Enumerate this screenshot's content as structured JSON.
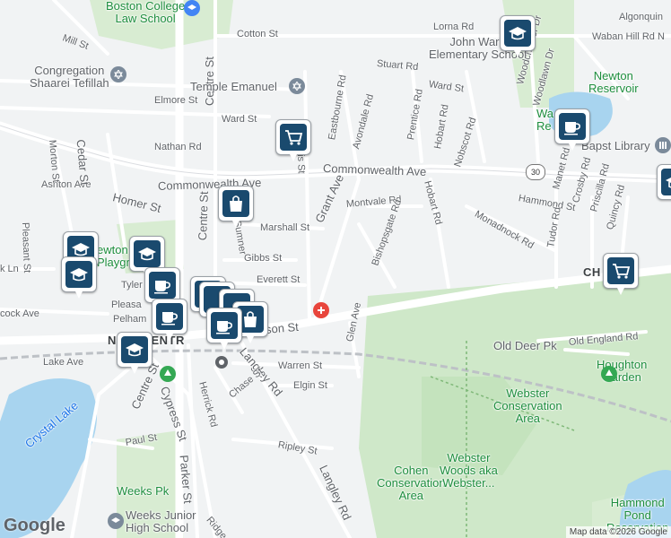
{
  "streets": [
    {
      "text": "Mill St"
    },
    {
      "text": "Cotton St"
    },
    {
      "text": "Lorna Rd"
    },
    {
      "text": "Algonquin"
    },
    {
      "text": "Stuart Rd"
    },
    {
      "text": "Ward St"
    },
    {
      "text": "Elmore St"
    },
    {
      "text": "Ward St"
    },
    {
      "text": "Nathan Rd"
    },
    {
      "text": "Francis St"
    },
    {
      "text": "Eastbourne Rd"
    },
    {
      "text": "Avondale Rd"
    },
    {
      "text": "Prentice Rd"
    },
    {
      "text": "Hobart Rd"
    },
    {
      "text": "Nobscot Rd"
    },
    {
      "text": "Woodchester Dr"
    },
    {
      "text": "Woodlawn Dr"
    },
    {
      "text": "Waban Hill Rd N"
    },
    {
      "text": "Commonwealth Ave"
    },
    {
      "text": "Commonwealth Ave"
    },
    {
      "text": "Homer St"
    },
    {
      "text": "Ashton Ave"
    },
    {
      "text": "Morton St"
    },
    {
      "text": "Cedar St"
    },
    {
      "text": "Centre St"
    },
    {
      "text": "Grant Ave"
    },
    {
      "text": "Montvale Rd"
    },
    {
      "text": "Hobart Rd"
    },
    {
      "text": "Hammond St"
    },
    {
      "text": "Manet Rd"
    },
    {
      "text": "Crosby Rd"
    },
    {
      "text": "Priscilla Rd"
    },
    {
      "text": "Quincy Rd"
    },
    {
      "text": "Monadnock Rd"
    },
    {
      "text": "Marshall St"
    },
    {
      "text": "Sumner"
    },
    {
      "text": "Centre St"
    },
    {
      "text": "Pleasant St"
    },
    {
      "text": "Gibbs St"
    },
    {
      "text": "Everett St"
    },
    {
      "text": "Tyler"
    },
    {
      "text": "Bishopsgate Rd"
    },
    {
      "text": "Tudor Rd"
    },
    {
      "text": "Pleasa"
    },
    {
      "text": "Pelham"
    },
    {
      "text": "cock Ave"
    },
    {
      "text": "Lake Ave"
    },
    {
      "text": "Glen Ave"
    },
    {
      "text": "son St"
    },
    {
      "text": "Langley Rd"
    },
    {
      "text": "Warren St"
    },
    {
      "text": "Old Deer Pk"
    },
    {
      "text": "Old England Rd"
    },
    {
      "text": "Centre St"
    },
    {
      "text": "Cypress St"
    },
    {
      "text": "Herrick Rd"
    },
    {
      "text": "Chase St"
    },
    {
      "text": "Elgin St"
    },
    {
      "text": "Paul St"
    },
    {
      "text": "Parker St"
    },
    {
      "text": "Ripley St"
    },
    {
      "text": "Langley Rd"
    },
    {
      "text": "Ridge"
    },
    {
      "text": "k Ln"
    }
  ],
  "places": [
    {
      "text": "Boston College\nLaw School"
    },
    {
      "text": "John Ward\nElementary School"
    },
    {
      "text": "Congregation\nShaarei Tefillah"
    },
    {
      "text": "Temple Emanuel"
    },
    {
      "text": "Newton\nReservoir"
    },
    {
      "text": "Bapst Library"
    },
    {
      "text": "Wa\nRe"
    },
    {
      "text": "ewton\nPlaygr"
    },
    {
      "text": "Houghton\nGarden"
    },
    {
      "text": "Webster\nConservation\nArea"
    },
    {
      "text": "Cohen\nConservation\nArea"
    },
    {
      "text": "Webster\nWoods aka\nWebster..."
    },
    {
      "text": "Crystal Lake"
    },
    {
      "text": "Weeks Pk"
    },
    {
      "text": "Weeks Junior\nHigh School"
    },
    {
      "text": "Hammond\nPond\nReservation"
    }
  ],
  "districts": [
    {
      "text": "N ON CENTR"
    },
    {
      "text": "CH    UT H"
    }
  ],
  "route_shield": "30",
  "pins": [
    {
      "icon": "school-icon"
    },
    {
      "icon": "grocery-cart-icon"
    },
    {
      "icon": "shopping-bag-icon"
    },
    {
      "icon": "school-icon"
    },
    {
      "icon": "school-icon"
    },
    {
      "icon": "school-icon"
    },
    {
      "icon": "coffee-cup-icon"
    },
    {
      "icon": "coffee-cup-icon"
    },
    {
      "icon": "coffee-cup-icon"
    },
    {
      "icon": "school-icon"
    },
    {
      "icon": "coffee-cup-icon"
    },
    {
      "icon": "grocery-cart-icon"
    },
    {
      "icon": "school-icon"
    },
    {
      "icon": "shopping-bag-icon"
    }
  ],
  "branding": {
    "logo": "Google",
    "credit": "Map data ©2026 Google"
  }
}
